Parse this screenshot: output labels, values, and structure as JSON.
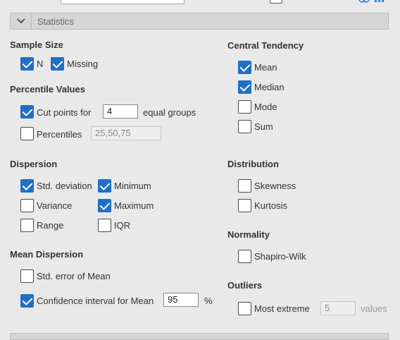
{
  "header": {
    "title": "Statistics"
  },
  "sample_size": {
    "heading": "Sample Size",
    "n_label": "N",
    "missing_label": "Missing"
  },
  "percentile_values": {
    "heading": "Percentile Values",
    "cut_points_label": "Cut points for",
    "cut_points_value": "4",
    "equal_groups_label": "equal groups",
    "percentiles_label": "Percentiles",
    "percentiles_value": "25,50,75"
  },
  "dispersion": {
    "heading": "Dispersion",
    "std_dev": "Std. deviation",
    "minimum": "Minimum",
    "variance": "Variance",
    "maximum": "Maximum",
    "range": "Range",
    "iqr": "IQR"
  },
  "mean_dispersion": {
    "heading": "Mean Dispersion",
    "std_error": "Std. error of Mean",
    "ci_label": "Confidence interval for Mean",
    "ci_value": "95",
    "ci_unit": "%"
  },
  "central_tendency": {
    "heading": "Central Tendency",
    "mean": "Mean",
    "median": "Median",
    "mode": "Mode",
    "sum": "Sum"
  },
  "distribution": {
    "heading": "Distribution",
    "skewness": "Skewness",
    "kurtosis": "Kurtosis"
  },
  "normality": {
    "heading": "Normality",
    "shapiro": "Shapiro-Wilk"
  },
  "outliers": {
    "heading": "Outliers",
    "most_extreme": "Most extreme",
    "value": "5",
    "unit": "values"
  }
}
